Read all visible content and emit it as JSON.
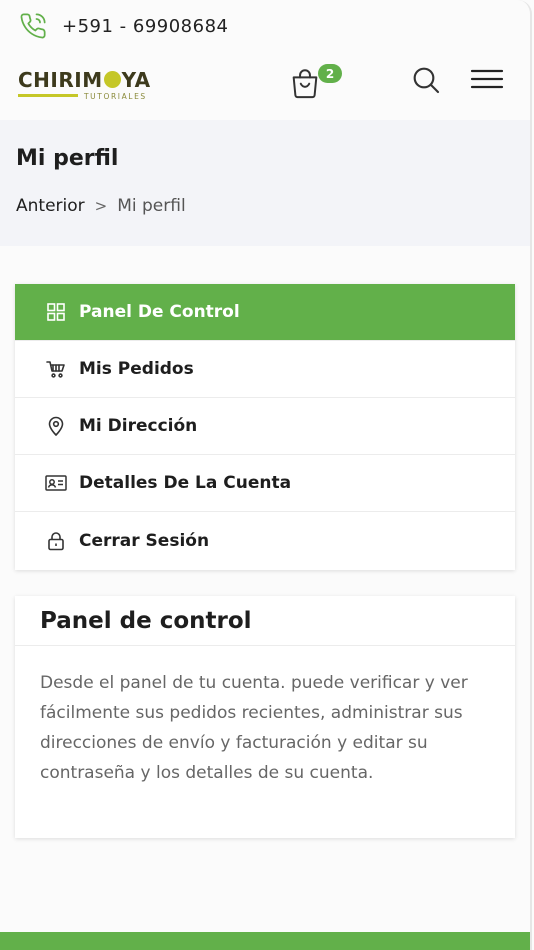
{
  "colors": {
    "accent": "#62b04a",
    "logo": "#c5c728",
    "band": "#f3f4f8"
  },
  "topbar": {
    "phone_icon": "phone-icon",
    "phone": "+591 - 69908684"
  },
  "header": {
    "logo_text_a": "CHIRIM",
    "logo_text_b": "YA",
    "logo_sub": "TUTORIALES",
    "cart_icon": "shopping-bag-icon",
    "cart_count": "2",
    "search_icon": "search-icon",
    "menu_icon": "hamburger-menu-icon"
  },
  "page": {
    "title": "Mi perfil",
    "breadcrumb_prev": "Anterior",
    "breadcrumb_sep": ">",
    "breadcrumb_current": "Mi perfil"
  },
  "account_menu": {
    "items": [
      {
        "label": "Panel De Control",
        "icon": "grid-icon",
        "active": true
      },
      {
        "label": "Mis Pedidos",
        "icon": "cart-icon",
        "active": false
      },
      {
        "label": "Mi Dirección",
        "icon": "location-pin-icon",
        "active": false
      },
      {
        "label": "Detalles De La Cuenta",
        "icon": "id-card-icon",
        "active": false
      },
      {
        "label": "Cerrar Sesión",
        "icon": "lock-icon",
        "active": false
      }
    ]
  },
  "panel": {
    "title": "Panel de control",
    "body": "Desde el panel de tu cuenta. puede verificar y ver fácilmente sus pedidos recientes, administrar sus direcciones de envío y facturación y editar su contraseña y los detalles de su cuenta."
  }
}
